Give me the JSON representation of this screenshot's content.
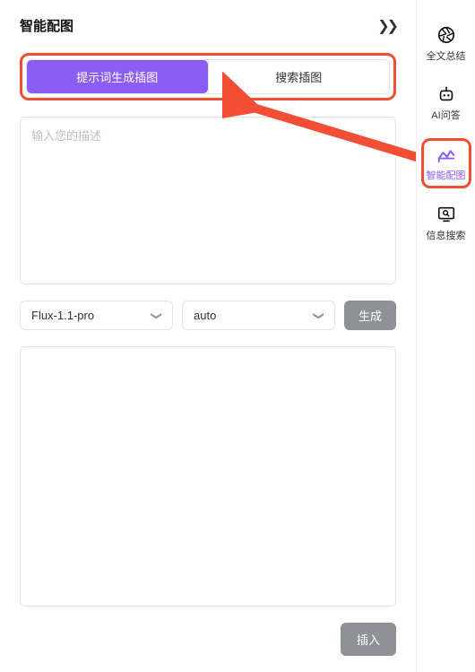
{
  "header": {
    "title": "智能配图"
  },
  "tabs": {
    "generate": "提示词生成插图",
    "search": "搜索插图"
  },
  "input": {
    "placeholder": "输入您的描述"
  },
  "selects": {
    "model": "Flux-1.1-pro",
    "aspect": "auto"
  },
  "buttons": {
    "generate": "生成",
    "insert": "插入"
  },
  "sidebar": {
    "items": [
      {
        "label": "全文总结"
      },
      {
        "label": "AI问答"
      },
      {
        "label": "智能配图"
      },
      {
        "label": "信息搜索"
      }
    ]
  }
}
